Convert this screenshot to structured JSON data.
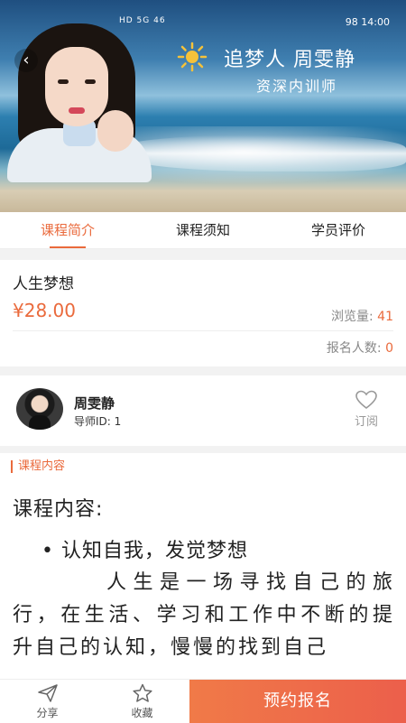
{
  "hero": {
    "status_left": "HD 5G  46",
    "status_right": "98  14:00",
    "title": "追梦人 周雯静",
    "subtitle": "资深内训师",
    "back_icon": "chevron-left-icon"
  },
  "tabs": [
    {
      "label": "课程简介",
      "active": true
    },
    {
      "label": "课程须知",
      "active": false
    },
    {
      "label": "学员评价",
      "active": false
    }
  ],
  "course": {
    "name": "人生梦想",
    "price": "¥28.00",
    "views_label": "浏览量:",
    "views_value": "41",
    "enroll_label": "报名人数:",
    "enroll_value": "0"
  },
  "teacher": {
    "name": "周雯静",
    "id_text": "导师ID: 1",
    "subscribe_label": "订阅"
  },
  "content": {
    "section_label": "课程内容",
    "title": "课程内容:",
    "bullet": "认知自我，发觉梦想",
    "paragraph": "人生是一场寻找自己的旅行，在生活、学习和工作中不断的提升自己的认知，慢慢的找到自己"
  },
  "bottom_bar": {
    "share_label": "分享",
    "favorite_label": "收藏",
    "cta_label": "预约报名"
  },
  "colors": {
    "accent": "#ea6a3c",
    "cta_start": "#f07a48",
    "cta_end": "#ec5f4b"
  }
}
